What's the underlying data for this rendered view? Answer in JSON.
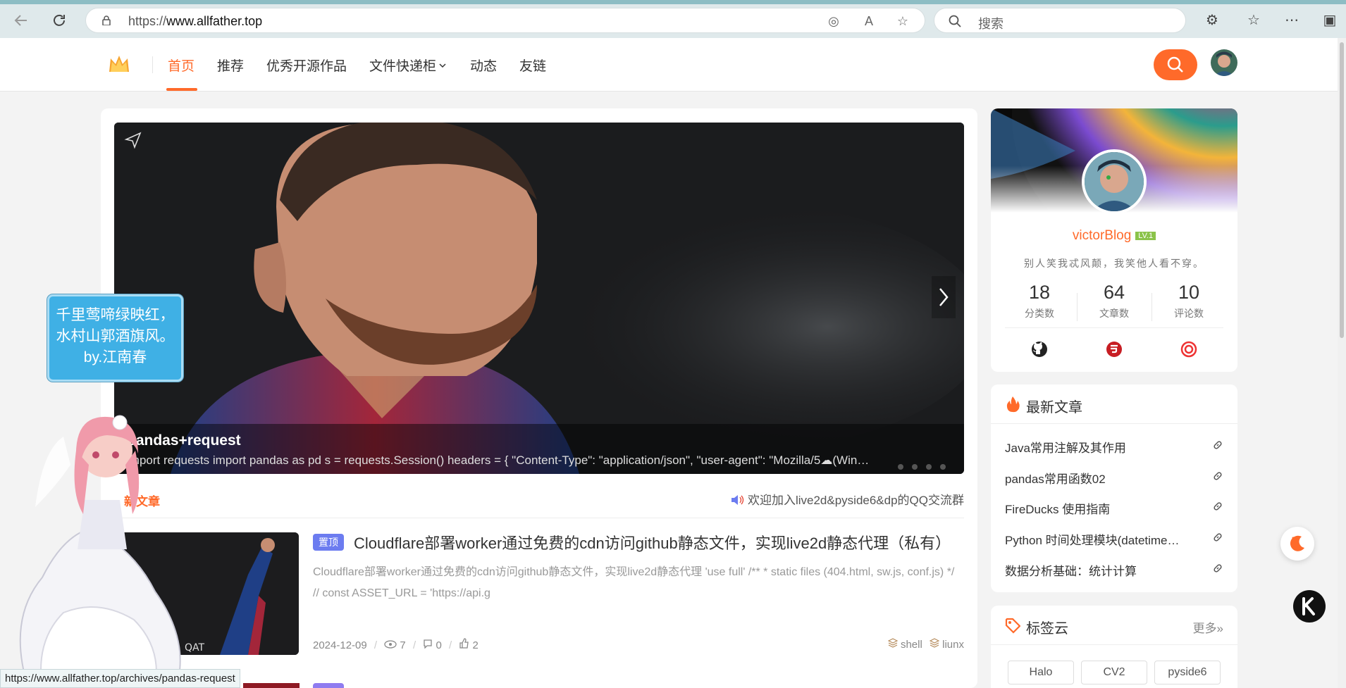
{
  "browser": {
    "url_prefix": "https://",
    "url_host": "www.allfather.top",
    "search_placeholder": "搜索"
  },
  "nav": {
    "items": [
      {
        "label": "首页"
      },
      {
        "label": "推荐"
      },
      {
        "label": "优秀开源作品"
      },
      {
        "label": "文件快递柜"
      },
      {
        "label": "动态"
      },
      {
        "label": "友链"
      }
    ]
  },
  "carousel": {
    "title": "pandas+request",
    "summary": "import requests import pandas as pd s = requests.Session() headers = { \"Content-Type\": \"application/json\", \"user-agent\": \"Mozilla/5☁(Win…"
  },
  "main": {
    "section_title": "新文章",
    "notice": "欢迎加入live2d&pyside6&dp的QQ交流群"
  },
  "post": {
    "pin_label": "置顶",
    "title": "Cloudflare部署worker通过免费的cdn访问github静态文件，实现live2d静态代理（私有）",
    "excerpt": "Cloudflare部署worker通过免费的cdn访问github静态文件，实现live2d静态代理 'use full' /** * static files (404.html, sw.js, conf.js) */ // const ASSET_URL = 'https://api.g",
    "date": "2024-12-09",
    "views": "7",
    "comments": "0",
    "likes": "2",
    "tags": [
      "shell",
      "liunx"
    ],
    "thumb_text": "QAT"
  },
  "profile": {
    "name": "victorBlog",
    "level": "LV.1",
    "motto": "别人笑我忒风颠，我笑他人看不穿。",
    "stats": [
      {
        "num": "18",
        "label": "分类数"
      },
      {
        "num": "64",
        "label": "文章数"
      },
      {
        "num": "10",
        "label": "评论数"
      }
    ]
  },
  "latest": {
    "title": "最新文章",
    "items": [
      {
        "title": "Java常用注解及其作用"
      },
      {
        "title": "pandas常用函数02"
      },
      {
        "title": "FireDucks 使用指南"
      },
      {
        "title": "Python 时间处理模块(datetime…"
      },
      {
        "title": "数据分析基础：统计计算"
      }
    ]
  },
  "tagcloud": {
    "title": "标签云",
    "more": "更多»",
    "tags": [
      "Halo",
      "CV2",
      "pyside6"
    ]
  },
  "live2d": {
    "message": "千里莺啼绿映红，水村山郭酒旗风。 by.江南春"
  },
  "statusbar": {
    "url": "https://www.allfather.top/archives/pandas-request"
  },
  "colors": {
    "accent": "#ff6a2a",
    "pin": "#6c7cf0"
  }
}
